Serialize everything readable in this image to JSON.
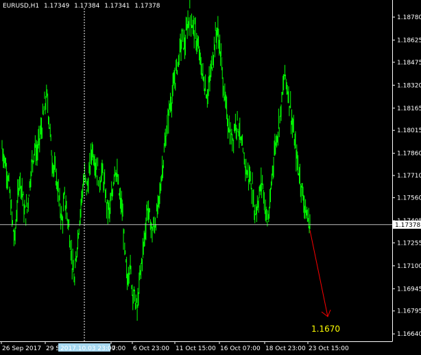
{
  "header": {
    "symbol": "EURUSD,H1",
    "open": "1.17349",
    "high": "1.17384",
    "low": "1.17341",
    "close": "1.17378"
  },
  "chart_data": {
    "type": "candlestick",
    "series": [
      {
        "values": [
          1.179,
          1.1782,
          1.1774,
          1.176,
          1.1742,
          1.1726,
          1.175,
          1.177,
          1.1762,
          1.1745,
          1.1748,
          1.1765,
          1.178,
          1.179,
          1.1786,
          1.1796,
          1.1805,
          1.1818,
          1.1824,
          1.1805,
          1.1782,
          1.1774,
          1.1766,
          1.1752,
          1.174,
          1.1756,
          1.1745,
          1.1732,
          1.1712,
          1.1698,
          1.1725,
          1.1742,
          1.176,
          1.177,
          1.1762,
          1.1774,
          1.179,
          1.1782,
          1.1775,
          1.1768,
          1.1774,
          1.1762,
          1.175,
          1.1746,
          1.1758,
          1.1778,
          1.177,
          1.1755,
          1.1748,
          1.172,
          1.17,
          1.1712,
          1.1696,
          1.1688,
          1.168,
          1.17,
          1.1716,
          1.173,
          1.175,
          1.1742,
          1.1733,
          1.1738,
          1.1745,
          1.1758,
          1.1776,
          1.179,
          1.1805,
          1.1818,
          1.1825,
          1.1836,
          1.1845,
          1.1855,
          1.1865,
          1.1858,
          1.1872,
          1.188,
          1.1873,
          1.1868,
          1.186,
          1.185,
          1.184,
          1.1832,
          1.1825,
          1.1835,
          1.1848,
          1.1862,
          1.187,
          1.1858,
          1.184,
          1.1822,
          1.181,
          1.18,
          1.1795,
          1.1805,
          1.1808,
          1.1798,
          1.1786,
          1.178,
          1.1772,
          1.177,
          1.1762,
          1.1745,
          1.1752,
          1.176,
          1.1768,
          1.175,
          1.174,
          1.1748,
          1.1775,
          1.179,
          1.18,
          1.181,
          1.1825,
          1.184,
          1.183,
          1.182,
          1.1805,
          1.1792,
          1.178,
          1.177,
          1.176,
          1.175,
          1.1742,
          1.1738
        ]
      }
    ],
    "y_axis": {
      "ticks": [
        1.1878,
        1.18625,
        1.18475,
        1.1832,
        1.18165,
        1.18015,
        1.1786,
        1.1771,
        1.1756,
        1.17405,
        1.17255,
        1.171,
        1.16945,
        1.16795,
        1.1664
      ],
      "tick_labels": [
        "1.18780",
        "1.18625",
        "1.18475",
        "1.18320",
        "1.18165",
        "1.18015",
        "1.17860",
        "1.17710",
        "1.17560",
        "1.17405",
        "1.17255",
        "1.17100",
        "1.16945",
        "1.16795",
        "1.16640"
      ],
      "min": 1.1659,
      "max": 1.1884
    },
    "x_axis": {
      "tick_labels": [
        "26 Sep 2017",
        "29 S",
        "7:00",
        "6 Oct 23:00",
        "11 Oct 15:00",
        "16 Oct 07:00",
        "18 Oct 23:00",
        "23 Oct 15:00"
      ]
    },
    "current_price_label": "1.17378",
    "current_price_value": 1.17378,
    "crosshair_label": "2017.10.03 23:00",
    "annotation": {
      "text": "1.1670",
      "value": 1.167
    },
    "colors": {
      "background": "#000000",
      "candles": "#00ff00",
      "text": "#ffffff",
      "price_line": "#c0c0c0",
      "arrow": "#ff0000",
      "annotation_text": "#ffff00",
      "crosshair_label_bg": "#a6d8f0"
    }
  }
}
